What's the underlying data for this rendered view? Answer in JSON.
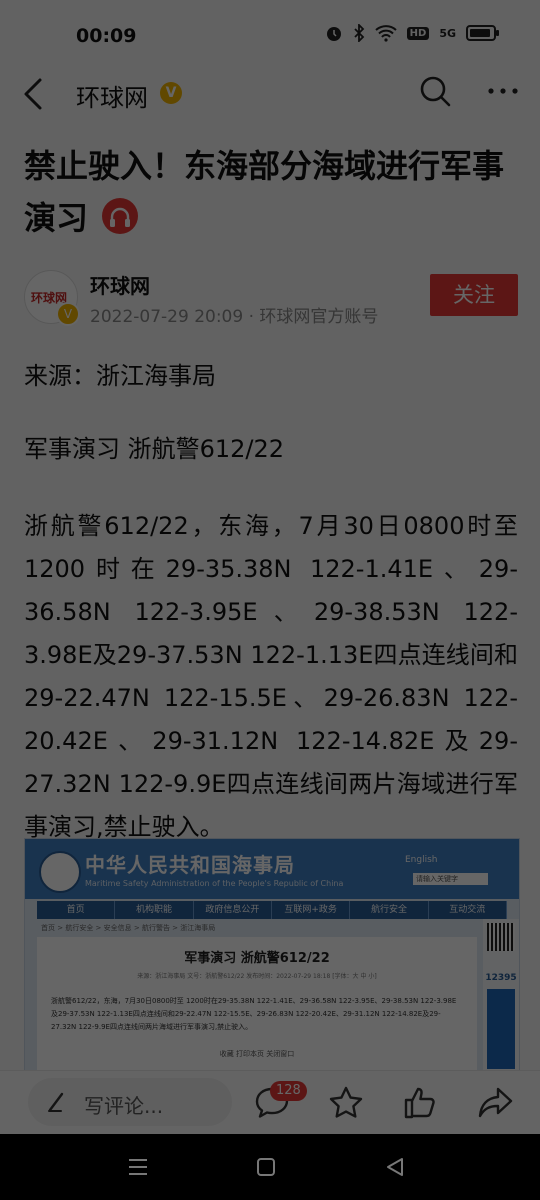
{
  "status_bar": {
    "time": "00:09",
    "hd": "HD",
    "network": "5G"
  },
  "app_bar": {
    "title": "环球网",
    "verified_mark": "V"
  },
  "article": {
    "headline": "禁止驶入！东海部分海域进行军事演习",
    "author_name": "环球网",
    "author_meta": "2022-07-29 20:09 · 环球网官方账号",
    "avatar_text": "环球网",
    "follow_label": "关注",
    "paragraphs": [
      "来源：浙江海事局",
      "军事演习 浙航警612/22",
      "浙航警612/22，东海，7月30日0800时至1200时在29-35.38N 122-1.41E、29-36.58N 122-3.95E、29-38.53N 122-3.98E及29-37.53N 122-1.13E四点连线间和29-22.47N 122-15.5E、29-26.83N 122-20.42E、29-31.12N 122-14.82E及29-27.32N 122-9.9E四点连线间两片海域进行军事演习,禁止驶入。"
    ]
  },
  "embedded_page": {
    "site_title": "中华人民共和国海事局",
    "site_subtitle": "Maritime Safety Administration of the People's Republic of China",
    "english_link": "English",
    "search_placeholder": "请输入关键字",
    "nav": [
      "首页",
      "机构职能",
      "政府信息公开",
      "互联网+政务",
      "航行安全",
      "互动交流"
    ],
    "breadcrumb": "首页 > 航行安全 > 安全信息 > 航行警告 > 浙江海事局",
    "title": "军事演习 浙航警612/22",
    "meta": "来源：浙江海事局    文号：浙航警612/22    发布时间：2022-07-29 18:18    [字体：大 中 小]",
    "body": "浙航警612/22，东海，7月30日0800时至 1200时在29-35.38N 122-1.41E、29-36.58N 122-3.95E、29-38.53N 122-3.98E及29-37.53N 122-1.13E四点连线间和29-22.47N 122-15.5E、29-26.83N 122-20.42E、29-31.12N 122-14.82E及29-27.32N 122-9.9E四点连线间两片海域进行军事演习,禁止驶入。",
    "links": "收藏    打印本页    关闭窗口",
    "hotline": "12395"
  },
  "bottom_bar": {
    "comment_placeholder": "写评论...",
    "comment_count": "128"
  }
}
